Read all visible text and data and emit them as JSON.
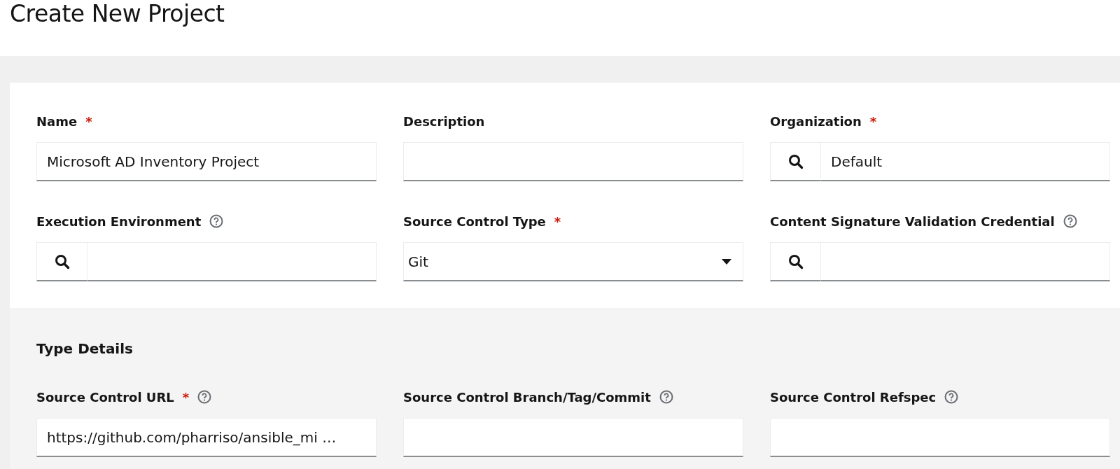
{
  "page_title": "Create New Project",
  "general_fields": [
    {
      "label": "Name",
      "required_mark": "*",
      "help": false,
      "kind": "text",
      "value": "Microsoft AD Inventory Project"
    },
    {
      "label": "Description",
      "help": false,
      "kind": "text"
    },
    {
      "label": "Organization",
      "required_mark": "*",
      "help": false,
      "kind": "lookup",
      "value": "Default"
    },
    {
      "label": "Execution Environment",
      "help": true,
      "kind": "lookup"
    },
    {
      "label": "Source Control Type",
      "required_mark": "*",
      "help": false,
      "kind": "select",
      "value": "Git"
    },
    {
      "label": "Content Signature Validation Credential",
      "help": true,
      "kind": "lookup"
    }
  ],
  "type_details": {
    "title": "Type Details",
    "fields": [
      {
        "label": "Source Control URL",
        "required_mark": "*",
        "help": true,
        "kind": "text",
        "value": "https://github.com/pharriso/ansible_mi …"
      },
      {
        "label": "Source Control Branch/Tag/Commit",
        "help": true,
        "kind": "text"
      },
      {
        "label": "Source Control Refspec",
        "help": true,
        "kind": "text"
      }
    ]
  }
}
